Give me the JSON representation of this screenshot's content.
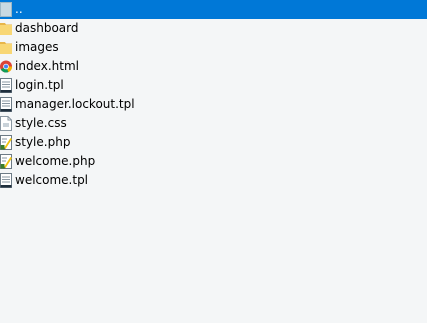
{
  "file_list": {
    "items": [
      {
        "name": "..",
        "icon": "parent-folder-icon",
        "selected": true
      },
      {
        "name": "dashboard",
        "icon": "folder-icon"
      },
      {
        "name": "images",
        "icon": "folder-icon"
      },
      {
        "name": "index.html",
        "icon": "chrome-icon"
      },
      {
        "name": "login.tpl",
        "icon": "text-file-icon"
      },
      {
        "name": "manager.lockout.tpl",
        "icon": "text-file-icon"
      },
      {
        "name": "style.css",
        "icon": "css-file-icon"
      },
      {
        "name": "style.php",
        "icon": "php-edit-icon"
      },
      {
        "name": "welcome.php",
        "icon": "php-edit-icon"
      },
      {
        "name": "welcome.tpl",
        "icon": "text-file-icon"
      }
    ]
  },
  "colors": {
    "background": "#f4f6f7",
    "selection": "#0078d7",
    "folder": "#f8d775"
  }
}
